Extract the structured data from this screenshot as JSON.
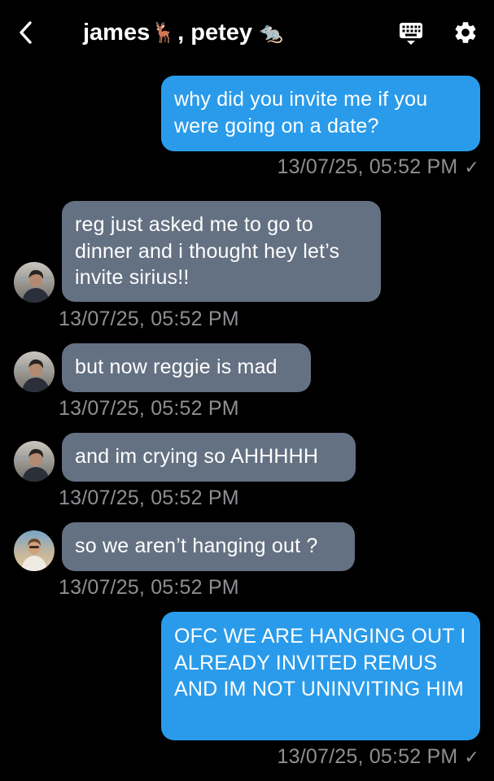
{
  "header": {
    "title_part1": "james",
    "title_emoji1": "🦌",
    "title_sep": ", petey",
    "title_emoji2": "🐀",
    "back_icon": "chevron-left-icon",
    "keyboard_icon": "keyboard-icon",
    "settings_icon": "gear-icon"
  },
  "colors": {
    "background": "#000000",
    "outgoing_bubble": "#2a9bea",
    "incoming_bubble": "#647182",
    "timestamp": "#8e8e93"
  },
  "messages": [
    {
      "direction": "outgoing",
      "text": "why did you invite me if you were going on a date?",
      "timestamp": "13/07/25, 05:52 PM",
      "read_mark": "✓"
    },
    {
      "direction": "incoming",
      "sender": "james",
      "text": "reg just asked me to go to dinner and i thought hey let’s invite sirius!!",
      "timestamp": "13/07/25, 05:52 PM"
    },
    {
      "direction": "incoming",
      "sender": "james",
      "text": "but now reggie is mad",
      "timestamp": "13/07/25, 05:52 PM"
    },
    {
      "direction": "incoming",
      "sender": "james",
      "text": "and im crying so AHHHHH",
      "timestamp": "13/07/25, 05:52 PM"
    },
    {
      "direction": "incoming",
      "sender": "petey",
      "text": "so we aren’t hanging out ?",
      "timestamp": "13/07/25, 05:52 PM"
    },
    {
      "direction": "outgoing",
      "text": "OFC WE ARE HANGING OUT I ALREADY INVITED REMUS AND IM NOT UNINVITING HIM",
      "timestamp": "13/07/25, 05:52 PM",
      "read_mark": "✓"
    }
  ]
}
